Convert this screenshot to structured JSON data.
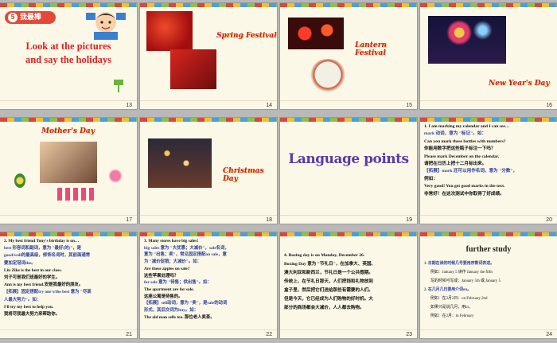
{
  "slides": [
    {
      "num": "13",
      "badge_num": "5",
      "badge_text": "我最棒",
      "title_line1": "Look at the pictures",
      "title_line2": "and say the holidays"
    },
    {
      "num": "14",
      "title": "Spring Festival"
    },
    {
      "num": "15",
      "title": "Lantern Festival"
    },
    {
      "num": "16",
      "title": "New Year's Day"
    },
    {
      "num": "17",
      "title": "Mother's Day"
    },
    {
      "num": "18",
      "title": "Christmas Day"
    },
    {
      "num": "19",
      "title": "Language points"
    },
    {
      "num": "20",
      "lines": [
        "1. I am marking my calendar and I can see…",
        "mark 动词，意为 \"标记\"。如：",
        "Can you mark these bottles with numbers?",
        "你能用数字把这些瓶子标注一下吗？",
        "Please mark December on the calendar.",
        "请把在日历上把十二月标出来。",
        "【拓展】mark 还可以用作名词，意为 \"分数\"，",
        "例如：",
        "Very good! You get good marks in the text.",
        "非常好！在这次测试中你取得了好成绩。"
      ]
    },
    {
      "num": "21",
      "lines": [
        "2. My best friend Tony's birthday is on…",
        "best 形容词和副词，意为 \"最好(的)\"，是",
        "good/well的最高级，修饰名词时，其前面通常",
        "要加定冠词the。",
        "Liu Zike is the best in our class.",
        "刘子可是我们班最好的学生。",
        "Ann is my best friend.安是我最好的朋友。",
        "【拓展】固定搭配try one's/the best 意为 \"尽某",
        "人最大努力\"。如：",
        "I'll try my best to help you.",
        "我将尽我最大努力来帮助你。"
      ]
    },
    {
      "num": "22",
      "lines": [
        "3. Many stores have big sales!",
        "big sales 意为 \"大优惠；大减价\"，sale名词，",
        "意为 \"出售；卖\"，常见固定搭配on sale，意",
        "为 \"减价促销；大减价\"。如：",
        "Are these apples on sale?",
        "这些苹果处理吗？",
        "for sale 意为 \"待售；供出售\"。如：",
        "The apartment are for sale.",
        "这座公寓是待售的。",
        "【拓展】sell动词，意为 \"卖\"，是sale的动词",
        "形式，其后交词为buy。如：",
        "The old man sells tea. 那位老人卖茶。"
      ]
    },
    {
      "num": "23",
      "lines": [
        "4. Boxing day is on Monday, December 26.",
        "Boxing Day 意为 \"节礼日\"，在加拿大、英国、",
        "澳大利亚和新西兰，节礼日是一个公共假期。",
        "传统上，在节礼日那天，人们把钱和礼物放到",
        "盒子里，然后把它们送给那些有需要的人们。",
        "但是今天，它已经成为人们购物的好时机。大",
        "部分的商场都会大减价，人人都去购物。"
      ]
    },
    {
      "num": "24",
      "title": "further study",
      "items": [
        "1. 日期在读的时候几号要用序数词表述。",
        "例如：January 5 读作 January the fifth",
        "写的时候可写成：January 5th 或 January 5",
        "2. 在几月几日要用介词on。",
        "例如：在2月2日：on February 2nd",
        "如果只是说几月，用in。",
        "例如：在2月：in February"
      ]
    }
  ]
}
